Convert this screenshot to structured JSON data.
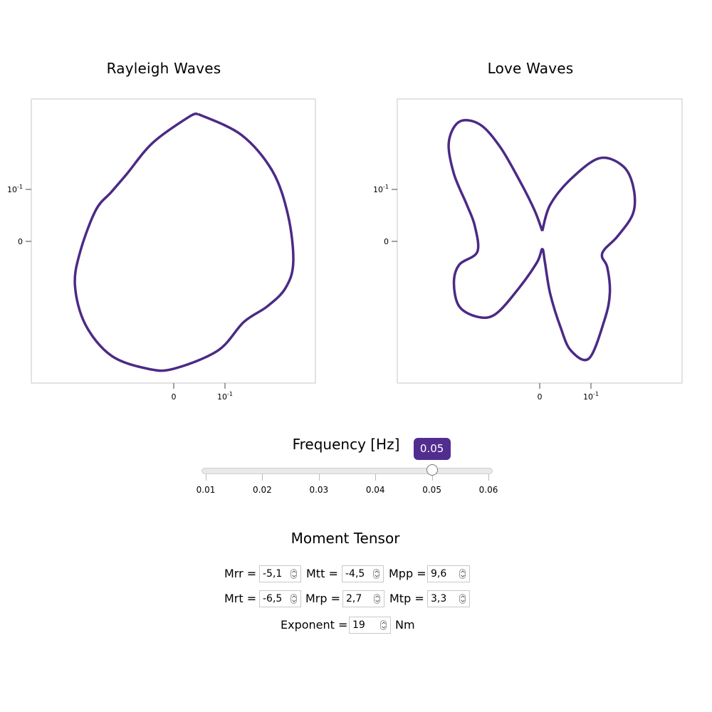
{
  "chart_data": [
    {
      "type": "line",
      "title": "Rayleigh Waves",
      "xaxis": {
        "tick_labels": [
          "0",
          "10-1"
        ]
      },
      "yaxis": {
        "tick_labels": [
          "10-1",
          "0"
        ]
      },
      "grid": false,
      "series": [
        {
          "color": "#4b2a85",
          "x": [
            0.047,
            0.13,
            0.19,
            0.22,
            0.23,
            0.215,
            0.18,
            0.135,
            0.085,
            0.0,
            -0.05,
            -0.12,
            -0.17,
            -0.19,
            -0.18,
            -0.15,
            -0.12,
            -0.09,
            -0.04,
            0.03,
            0.047
          ],
          "y": [
            0.245,
            0.205,
            0.135,
            0.05,
            -0.04,
            -0.09,
            -0.125,
            -0.155,
            -0.21,
            -0.245,
            -0.245,
            -0.22,
            -0.16,
            -0.085,
            -0.02,
            0.06,
            0.095,
            0.13,
            0.19,
            0.24,
            0.245
          ]
        }
      ]
    },
    {
      "type": "line",
      "title": "Love Waves",
      "xaxis": {
        "tick_labels": [
          "0",
          "10-1"
        ]
      },
      "yaxis": {
        "tick_labels": [
          "10-1",
          "0"
        ]
      },
      "grid": false,
      "series": [
        {
          "color": "#4b2a85",
          "x": [
            0.005,
            0.02,
            0.06,
            0.115,
            0.16,
            0.18,
            0.18,
            0.15,
            0.125,
            0.12,
            0.13,
            0.135,
            0.125,
            0.095,
            0.06,
            0.04,
            0.02,
            0.01,
            0.005,
            -0.005,
            -0.04,
            -0.085,
            -0.12,
            -0.155,
            -0.165,
            -0.155,
            -0.12,
            -0.125,
            -0.14,
            -0.165,
            -0.175,
            -0.155,
            -0.115,
            -0.075,
            -0.035,
            -0.01,
            0.005
          ],
          "y": [
            0.02,
            0.07,
            0.12,
            0.16,
            0.145,
            0.105,
            0.055,
            0.01,
            -0.015,
            -0.03,
            -0.05,
            -0.1,
            -0.15,
            -0.225,
            -0.21,
            -0.165,
            -0.1,
            -0.04,
            -0.015,
            -0.04,
            -0.09,
            -0.14,
            -0.145,
            -0.125,
            -0.08,
            -0.045,
            -0.02,
            0.03,
            0.07,
            0.13,
            0.19,
            0.23,
            0.225,
            0.18,
            0.11,
            0.06,
            0.02
          ]
        }
      ]
    }
  ],
  "frequency_slider": {
    "title": "Frequency [Hz]",
    "value": 0.05,
    "value_label": "0.05",
    "min": 0.01,
    "max": 0.06,
    "ticks": [
      "0.01",
      "0.02",
      "0.03",
      "0.04",
      "0.05",
      "0.06"
    ]
  },
  "moment_tensor": {
    "title": "Moment Tensor",
    "rows": [
      [
        {
          "label": "Mrr =",
          "value": "-5,1"
        },
        {
          "label": "Mtt =",
          "value": "-4,5"
        },
        {
          "label": "Mpp =",
          "value": "9,6"
        }
      ],
      [
        {
          "label": "Mrt =",
          "value": "-6,5"
        },
        {
          "label": "Mrp =",
          "value": "2,7"
        },
        {
          "label": "Mtp =",
          "value": "3,3"
        }
      ]
    ],
    "exponent": {
      "label": "Exponent =",
      "value": "19",
      "unit": "Nm"
    }
  }
}
